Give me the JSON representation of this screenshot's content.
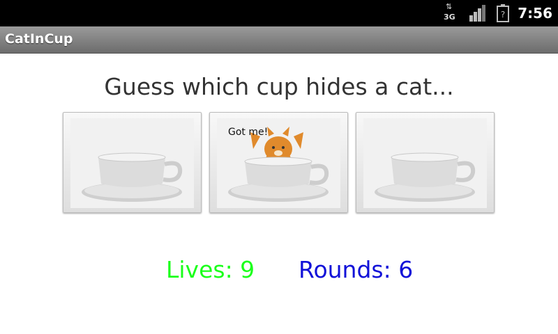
{
  "status_bar": {
    "network_label": "3G",
    "time": "7:56",
    "icons": [
      "data-arrows-icon",
      "signal-icon",
      "battery-unknown-icon"
    ]
  },
  "app": {
    "title": "CatInCup"
  },
  "game": {
    "headline": "Guess which cup hides a cat...",
    "cups": [
      {
        "state": "empty"
      },
      {
        "state": "cat",
        "caption": "Got me!"
      },
      {
        "state": "empty"
      }
    ],
    "lives_text": "Lives: 9",
    "rounds_text": "Rounds: 6"
  },
  "colors": {
    "lives": "#1bff1b",
    "rounds": "#1111d8",
    "headline": "#333333",
    "title_bar": "#8a8a8a",
    "cat": "#e08a2c"
  }
}
